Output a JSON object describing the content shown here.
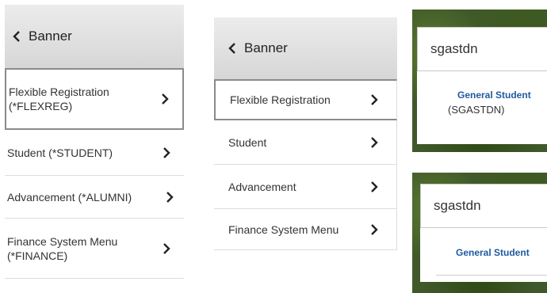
{
  "panel_1": {
    "header": "Banner",
    "items": [
      {
        "label": "Flexible Registration (*FLEXREG)",
        "selected": true
      },
      {
        "label": "Student (*STUDENT)",
        "selected": false
      },
      {
        "label": "Advancement (*ALUMNI)",
        "selected": false
      },
      {
        "label": "Finance System Menu (*FINANCE)",
        "selected": false
      }
    ]
  },
  "panel_2": {
    "header": "Banner",
    "items": [
      {
        "label": "Flexible Registration",
        "selected": true
      },
      {
        "label": "Student",
        "selected": false
      },
      {
        "label": "Advancement",
        "selected": false
      },
      {
        "label": "Finance System Menu",
        "selected": false
      }
    ]
  },
  "search_card_1": {
    "query": "sgastdn",
    "result": {
      "name": "General Student",
      "code": "(SGASTDN)"
    }
  },
  "search_card_2": {
    "query": "sgastdn",
    "result": {
      "name": "General Student"
    }
  },
  "icons": {
    "back": "chevron-left-icon",
    "forward": "chevron-right-icon"
  },
  "colors": {
    "header_bg": "#d6d6d6",
    "result_link": "#1f5aa0",
    "selected_border": "#8a8a8a"
  }
}
